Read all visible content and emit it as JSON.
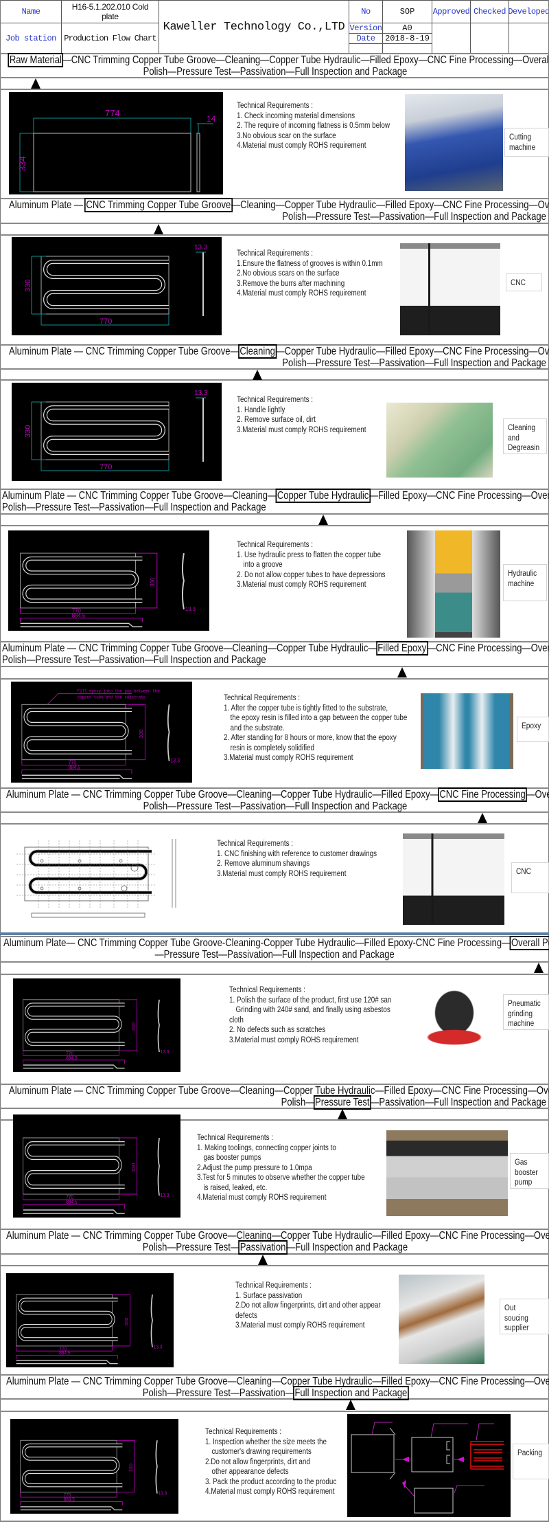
{
  "header": {
    "name_label": "Name",
    "name_value": "H16-5.1.202.010 Cold plate",
    "job_station_label": "Job station",
    "job_station_value": "Production Flow Chart",
    "company": "Kaweller Technology Co.,LTD",
    "no_label": "No",
    "no_value": "SOP",
    "version_label": "Version",
    "version_value": "A0",
    "date_label": "Date",
    "date_value": "2018-8-19",
    "approved_label": "Approved",
    "checked_label": "Checked",
    "developed_label": "Developed",
    "label_color": "#2636c8"
  },
  "flows": [
    {
      "line1": [
        {
          "text": "Raw Material",
          "highlight": true
        },
        {
          "text": "—CNC Trimming Copper Tube Groove—Cleaning—Copper Tube Hydraulic—Filled Epoxy—CNC Fine Processing—Overall"
        }
      ],
      "line2": [
        {
          "text": "Polish—Pressure Test—Passivation—Full Inspection and Package"
        }
      ]
    },
    {
      "line1": [
        {
          "text": "Aluminum Plate —  "
        },
        {
          "text": "CNC Trimming Copper Tube Groove",
          "highlight": true
        },
        {
          "text": "—Cleaning—Copper Tube Hydraulic—Filled Epoxy—CNC Fine Processing—Overall"
        }
      ],
      "line2": [
        {
          "text": "Polish—Pressure Test—Passivation—Full Inspection and Package"
        }
      ]
    },
    {
      "line1": [
        {
          "text": "Aluminum Plate —  CNC Trimming Copper Tube Groove—"
        },
        {
          "text": "Cleaning",
          "highlight": true
        },
        {
          "text": "—Copper Tube Hydraulic—Filled Epoxy—CNC Fine Processing—Overall"
        }
      ],
      "line2": [
        {
          "text": "Polish—Pressure Test—Passivation—Full Inspection and Package"
        }
      ]
    },
    {
      "line1": [
        {
          "text": "Aluminum Plate —  CNC Trimming Copper Tube Groove—Cleaning—"
        },
        {
          "text": "Copper Tube Hydraulic",
          "highlight": true
        },
        {
          "text": "—Filled Epoxy—CNC Fine Processing—Overall"
        }
      ],
      "line2": [
        {
          "text": "Polish—Pressure Test—Passivation—Full Inspection and Package"
        }
      ]
    },
    {
      "line1": [
        {
          "text": "Aluminum Plate —  CNC Trimming Copper Tube Groove—Cleaning—Copper Tube Hydraulic—"
        },
        {
          "text": "Filled Epoxy",
          "highlight": true
        },
        {
          "text": "—CNC Fine Processing—Overall"
        }
      ],
      "line2": [
        {
          "text": "Polish—Pressure Test—Passivation—Full Inspection and Package"
        }
      ]
    },
    {
      "line1": [
        {
          "text": "Aluminum Plate —  CNC Trimming Copper Tube Groove—Cleaning—Copper Tube Hydraulic—Filled Epoxy—"
        },
        {
          "text": "CNC Fine Processing",
          "highlight": true
        },
        {
          "text": "—Overall"
        }
      ],
      "line2": [
        {
          "text": "Polish—Pressure Test—Passivation—Full Inspection and Package"
        }
      ]
    },
    {
      "line1": [
        {
          "text": "Aluminum Plate—  CNC Trimming Copper Tube Groove-Cleaning-Copper Tube Hydraulic—Filled Epoxy-CNC Fine Processing—"
        },
        {
          "text": "Overall Polish",
          "highlight": true
        }
      ],
      "line2": [
        {
          "text": "—Pressure Test—Passivation—Full Inspection and Package"
        }
      ]
    },
    {
      "line1": [
        {
          "text": "Aluminum Plate —  CNC Trimming Copper Tube Groove—Cleaning—Copper Tube Hydraulic—Filled Epoxy—CNC Fine Processing—Overall"
        }
      ],
      "line2": [
        {
          "text": "Polish—"
        },
        {
          "text": "Pressure Test",
          "highlight": true
        },
        {
          "text": "—Passivation—Full Inspection and Package"
        }
      ]
    },
    {
      "line1": [
        {
          "text": "Aluminum Plate —  CNC Trimming Copper Tube Groove—Cleaning—Copper Tube Hydraulic—Filled Epoxy—CNC Fine Processing—Overall"
        }
      ],
      "line2": [
        {
          "text": "Polish—Pressure Test—"
        },
        {
          "text": "Passivation",
          "highlight": true
        },
        {
          "text": "—Full Inspection and Package"
        }
      ]
    },
    {
      "line1": [
        {
          "text": "Aluminum Plate —  CNC Trimming Copper Tube Groove—Cleaning—Copper Tube Hydraulic—Filled Epoxy—CNC Fine Processing—Overall"
        }
      ],
      "line2": [
        {
          "text": "Polish—Pressure Test—Passivation—"
        },
        {
          "text": "Full Inspection and Package",
          "highlight": true
        }
      ]
    }
  ],
  "sections": [
    {
      "drawing": {
        "type": "plate",
        "dims": [
          "774",
          "14",
          "334"
        ]
      },
      "tech_title": "Technical Requirements :",
      "items": [
        [
          "1. Check incoming material dimensions"
        ],
        [
          "2. The require of incoming flatness is 0.5mm below"
        ],
        [
          "3.No obvious scar on the surface"
        ],
        [
          "4.Material must comply ROHS requirement"
        ]
      ],
      "photo": "cutting-machine-photo",
      "label": [
        "Cutting",
        "machine"
      ]
    },
    {
      "drawing": {
        "type": "groove",
        "dims": [
          "13.3",
          "330",
          "770"
        ]
      },
      "tech_title": "Technical Requirements :",
      "items": [
        [
          "1.Ensure the flatness of grooves is  within 0.1mm"
        ],
        [
          "2.No obvious scars on the surface"
        ],
        [
          "3.Remove the burrs after machining"
        ],
        [
          "4.Material must comply ROHS requirement"
        ]
      ],
      "photo": "cnc-machine-photo",
      "label": [
        "CNC"
      ]
    },
    {
      "drawing": {
        "type": "groove",
        "dims": [
          "13.3",
          "330",
          "770"
        ]
      },
      "tech_title": "Technical Requirements :",
      "items": [
        [
          "1. Handle lightly"
        ],
        [
          "2. Remove surface oil, dirt"
        ],
        [
          "3.Material must comply ROHS requirement"
        ]
      ],
      "photo": "cleaning-tank-photo",
      "label": [
        "Cleaning",
        "and",
        "Degreasin"
      ]
    },
    {
      "drawing": {
        "type": "hydraulic",
        "dims": [
          "770",
          "330",
          "884.5",
          "13.3"
        ]
      },
      "tech_title": "Technical Requirements :",
      "items": [
        [
          "1. Use hydraulic press to flatten the copper tube",
          "into a groove"
        ],
        [
          "2. Do not allow copper tubes to have depressions"
        ],
        [
          "3.Material must comply ROHS requirement"
        ]
      ],
      "photo": "hydraulic-press-photo",
      "label": [
        "Hydraulic",
        "machine"
      ]
    },
    {
      "drawing": {
        "type": "epoxy",
        "dims": [
          "770",
          "330",
          "884.5",
          "13.3"
        ],
        "note": [
          "Fill epoxy into the gap between the",
          "copper tube and the substrate"
        ]
      },
      "tech_title": "Technical Requirements :",
      "items": [
        [
          "1. After the copper tube is tightly fitted to the substrate,",
          "the epoxy resin is filled into a gap between the copper tube",
          "and the substrate."
        ],
        [
          "2. After standing for 8 hours or more, know that the epoxy",
          "resin is completely solidified"
        ],
        [
          "3.Material must comply ROHS requirement"
        ]
      ],
      "photo": "epoxy-cans-photo",
      "label": [
        "Epoxy"
      ]
    },
    {
      "drawing": {
        "type": "detail",
        "dims": []
      },
      "tech_title": "Technical Requirements :",
      "items": [
        [
          "1. CNC finishing with reference to customer drawings"
        ],
        [
          "2. Remove aluminum shavings"
        ],
        [
          "3.Material must comply ROHS requirement"
        ]
      ],
      "photo": "cnc-machine-photo",
      "label": [
        "CNC"
      ]
    },
    {
      "drawing": {
        "type": "hydraulic",
        "dims": [
          "770",
          "330",
          "884.5",
          "13.3"
        ]
      },
      "tech_title": "Technical Requirements :",
      "items": [
        [
          "1. Polish the surface of the product, first use 120# san",
          "Grinding with 240# sand, and finally using asbestos"
        ],
        [
          "cloth"
        ],
        [
          "2. No defects such as scratches"
        ],
        [
          "3.Material must comply ROHS requirement"
        ]
      ],
      "photo": "pneumatic-grinder-photo",
      "label": [
        "Pneumatic",
        "grinding",
        "machine"
      ]
    },
    {
      "drawing": {
        "type": "hydraulic",
        "dims": [
          "770",
          "330",
          "884.5",
          "13.3"
        ]
      },
      "tech_title": "Technical Requirements :",
      "items": [
        [
          "1. Making toolings, connecting copper joints to",
          "gas booster pumps"
        ],
        [
          "2.Adjust the pump pressure to 1.0mpa"
        ],
        [
          "3.Test for 5 minutes to observe whether the copper tube",
          "is raised, leaked, etc."
        ],
        [
          "4.Material must comply ROHS requirement"
        ]
      ],
      "photo": "gas-booster-pump-photo",
      "label": [
        "Gas",
        "booster",
        "pump"
      ]
    },
    {
      "drawing": {
        "type": "hydraulic",
        "dims": [
          "770",
          "330",
          "884.5",
          "13.3"
        ]
      },
      "tech_title": "Technical Requirements :",
      "items": [
        [
          "1. Surface passivation"
        ],
        [
          "2.Do not allow fingerprints, dirt and other appear"
        ],
        [
          "defects"
        ],
        [
          "3.Material must comply ROHS requirement"
        ]
      ],
      "photo": "passivation-line-photo",
      "label": [
        "Out",
        "soucing",
        "supplier"
      ]
    },
    {
      "drawing": {
        "type": "hydraulic",
        "dims": [
          "770",
          "330",
          "884.5",
          "13.3"
        ]
      },
      "tech_title": "Technical Requirements :",
      "items": [
        [
          "1. Inspection whether the size meets the",
          "customer's drawing requirements"
        ],
        [
          "2.Do not allow fingerprints, dirt and",
          "other appearance defects"
        ],
        [
          "3. Pack the product according to the produc"
        ],
        [
          "4.Material must comply ROHS requirement"
        ]
      ],
      "photo": "packing-diagram",
      "label": [
        "Packing"
      ]
    }
  ],
  "colors": {
    "dimension_magenta": "#c000c0",
    "dimension_teal": "#0f8f8f",
    "separator_blue": "#5b7fa6"
  }
}
